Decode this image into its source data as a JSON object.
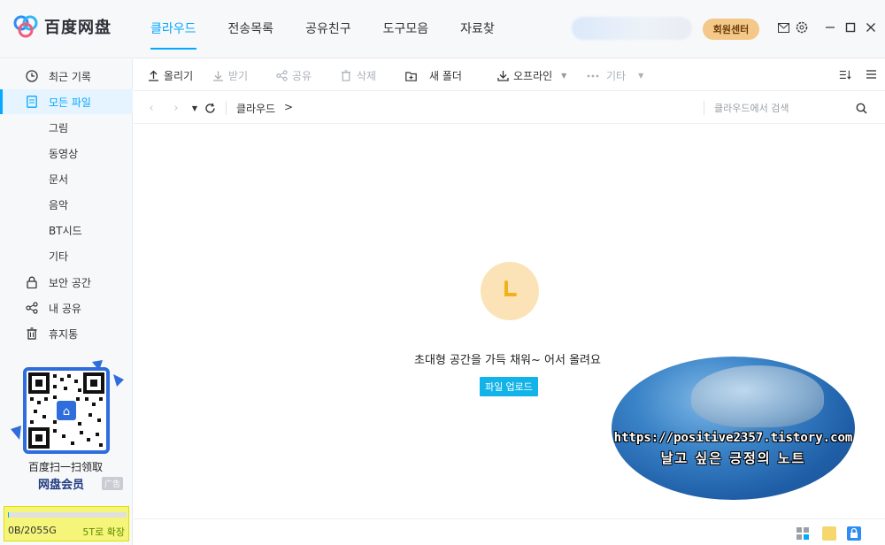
{
  "app": {
    "title": "百度网盘"
  },
  "nav": {
    "tabs": [
      {
        "label": "클라우드",
        "active": true
      },
      {
        "label": "전송목록",
        "active": false
      },
      {
        "label": "공유친구",
        "active": false
      },
      {
        "label": "도구모음",
        "active": false
      },
      {
        "label": "자료찾",
        "active": false
      }
    ],
    "vip_label": "회원센터"
  },
  "sidebar": {
    "items": [
      {
        "label": "최근 기록",
        "icon": "clock-icon"
      },
      {
        "label": "모든 파일",
        "icon": "file-icon",
        "active": true
      },
      {
        "label": "그림"
      },
      {
        "label": "동영상"
      },
      {
        "label": "문서"
      },
      {
        "label": "음악"
      },
      {
        "label": "BT시드"
      },
      {
        "label": "기타"
      },
      {
        "label": "보안 공간",
        "icon": "lock-icon"
      },
      {
        "label": "내 공유",
        "icon": "share-icon"
      },
      {
        "label": "휴지통",
        "icon": "trash-icon"
      }
    ],
    "promo": {
      "line1": "百度扫一扫领取",
      "line2": "网盘会员",
      "ad_tag": "广告"
    },
    "storage": {
      "used": "0B/2055G",
      "upgrade_label": "5T로 확장",
      "used_fraction": 0.0
    }
  },
  "toolbar": {
    "upload": "올리기",
    "download": "받기",
    "share": "공유",
    "delete": "삭제",
    "new_folder": "새 폴더",
    "offline": "오프라인",
    "more": "기타"
  },
  "pathbar": {
    "crumb": "클라우드",
    "separator": ">",
    "search_placeholder": "클라우드에서 검색"
  },
  "main": {
    "empty_text": "초대형 공간을 가득 채워~ 어서 올려요",
    "upload_button": "파일 업로드"
  },
  "watermark": {
    "url": "https://positive2357.tistory.com",
    "title": "날고 싶은 긍정의 노트"
  },
  "colors": {
    "accent": "#06a7ff",
    "vip": "#f3c888",
    "upload_button": "#12b3e8",
    "storage_highlight": "#f5f57a"
  }
}
